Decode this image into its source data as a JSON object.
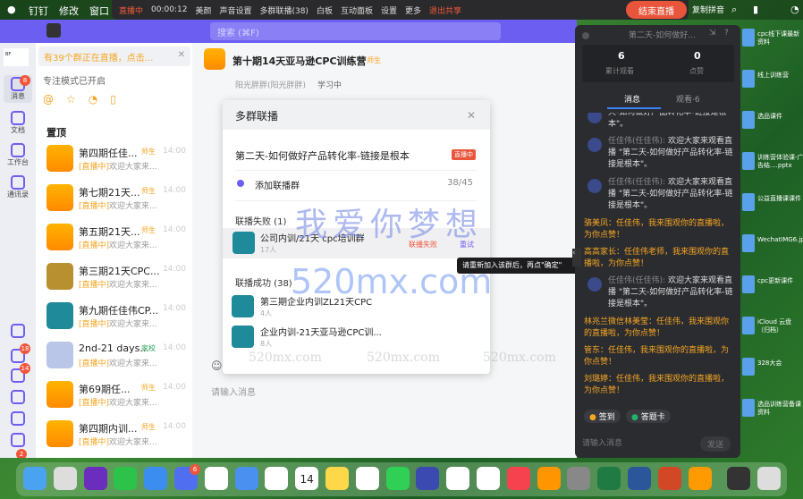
{
  "menubar": {
    "items": [
      "钉钉",
      "修改",
      "窗口"
    ],
    "right_text": "复制拼音"
  },
  "livebar": {
    "status": "直播中",
    "timer": "00:00:12",
    "items": [
      "美颜",
      "声音设置",
      "多群联播(38)",
      "白板",
      "互动面板",
      "设置",
      "更多"
    ],
    "exit_share": "退出共享",
    "end_live": "结束直播"
  },
  "window": {
    "search_placeholder": "搜索 (⌘F)"
  },
  "nav": {
    "items": [
      {
        "label": "消息",
        "badge": "8"
      },
      {
        "label": "文档"
      },
      {
        "label": "工作台"
      },
      {
        "label": "通讯录"
      }
    ],
    "bottom_badges": [
      "18",
      "14",
      "2"
    ],
    "logo": "Black Friday"
  },
  "list": {
    "notice": "有39个群正在直播，点击...",
    "focus_mode": "专注模式已开启",
    "pinned_label": "置顶",
    "items": [
      {
        "title": "第四期任佳...",
        "tag": "师生",
        "time": "14:00",
        "live": "[直播中]",
        "preview": "欢迎大家来..."
      },
      {
        "title": "第七期21天...",
        "tag": "师生",
        "time": "14:00",
        "live": "[直播中]",
        "preview": "欢迎大家来..."
      },
      {
        "title": "第五期21天...",
        "tag": "师生",
        "time": "14:00",
        "live": "[直播中]",
        "preview": "欢迎大家来..."
      },
      {
        "title": "第三期21天CPC...",
        "tag": "",
        "time": "14:00",
        "live": "[直播中]",
        "preview": "欢迎大家来..."
      },
      {
        "title": "第九期任佳伟CP...",
        "tag": "",
        "time": "14:00",
        "live": "[直播中]",
        "preview": "欢迎大家来..."
      },
      {
        "title": "2nd-21 days...",
        "tag": "家校",
        "time": "14:00",
        "live": "[直播中]",
        "preview": "欢迎大家来..."
      },
      {
        "title": "第69期任...",
        "tag": "师生",
        "time": "14:00",
        "live": "[直播中]",
        "preview": "欢迎大家来..."
      },
      {
        "title": "第四期内训...",
        "tag": "师生",
        "time": "14:00",
        "live": "[直播中]",
        "preview": "欢迎大家来..."
      }
    ]
  },
  "chat": {
    "title": "第十期14天亚马逊CPC训练营",
    "tag": "师生",
    "sender": "阳光胖胖(阳光胖胖)",
    "status": "学习中",
    "input_placeholder": "请输入消息"
  },
  "dialog": {
    "title": "多群联播",
    "live_title": "第二天-如何做好产品转化率-链接是根本",
    "live_badge": "直播中",
    "add_label": "添加联播群",
    "add_count": "38/45",
    "failed_header": "联播失败 (1)",
    "failed": [
      {
        "name": "公司内训/21天 cpc培训群",
        "count": "17人",
        "status": "联播失败",
        "retry": "重试"
      }
    ],
    "success_header": "联播成功 (38)",
    "success": [
      {
        "name": "第三期企业内训ZL21天CPC",
        "count": "4人"
      },
      {
        "name": "企业内训-21天亚马逊CPC训...",
        "count": "8人"
      }
    ],
    "tooltip": "请重新加入该群后，再点\"确定\""
  },
  "watermark": {
    "big": "我爱你梦想",
    "domain": "520mx.com"
  },
  "panel": {
    "title": "第二天-如何做好...",
    "views": "6",
    "views_label": "累计观看",
    "likes": "0",
    "likes_label": "点赞",
    "tabs": [
      "消息",
      "观看·6"
    ],
    "messages": [
      {
        "type": "sys",
        "name": "",
        "text": "天-如何做好产品转化率-链接是根本\"。"
      },
      {
        "type": "sys",
        "name": "任佳伟(任佳伟):",
        "text": "欢迎大家来观看直播 \"第二天-如何做好产品转化率-链接是根本\"。"
      },
      {
        "type": "sys",
        "name": "任佳伟(任佳伟):",
        "text": "欢迎大家来观看直播 \"第二天-如何做好产品转化率-链接是根本\"。"
      },
      {
        "type": "or",
        "text": "骆美凤：任佳伟，我来围观你的直播啦，为你点赞！"
      },
      {
        "type": "or",
        "text": "高高家长：任佳伟老师，我来围观你的直播啦，为你点赞！"
      },
      {
        "type": "sys",
        "name": "任佳伟(任佳伟):",
        "text": "欢迎大家来观看直播 \"第二天-如何做好产品转化率-链接是根本\"。"
      },
      {
        "type": "or",
        "text": "林兆兰微信林美莹：任佳伟，我来围观你的直播啦，为你点赞！"
      },
      {
        "type": "or",
        "text": "管东：任佳伟，我来围观你的直播啦，为你点赞！"
      },
      {
        "type": "or",
        "text": "刘璐婷：任佳伟，我来围观你的直播啦，为你点赞！"
      }
    ],
    "checkin": "签到",
    "quiz": "答题卡",
    "input_placeholder": "请输入消息",
    "send": "发送"
  },
  "desktop": {
    "items": [
      "cpc线下课最新资料",
      "线上训练营",
      "选品课件",
      "训练营体验课-广告结....pptx",
      "公益直播课课件",
      "WechatIMG6.jpeg",
      "cpc更新课件",
      "iCloud 云盘（归档）",
      "328大会",
      "选品训练营备课资料"
    ]
  },
  "dock": {
    "calendar_day": "14",
    "apps": [
      "finder",
      "launchpad",
      "siri",
      "wechat",
      "safari",
      "dingtalk",
      "chrome",
      "mail",
      "reminders",
      "calendar",
      "notes",
      "quicktime",
      "messages",
      "cloud",
      "pages",
      "numbers",
      "music",
      "books",
      "settings",
      "excel",
      "word",
      "powerpoint",
      "video",
      "preview",
      "trash"
    ],
    "dingtalk_badge": "6"
  }
}
